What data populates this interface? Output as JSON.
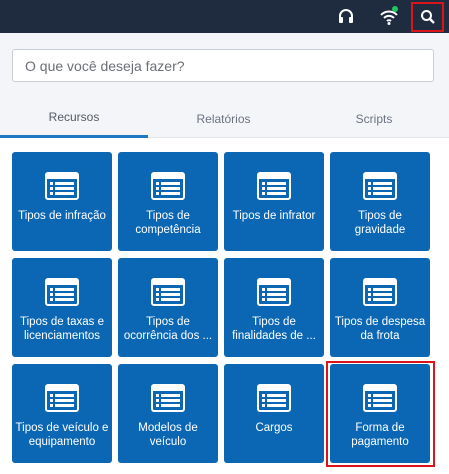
{
  "topbar": {
    "icons": [
      "headset-icon",
      "wifi-icon",
      "search-icon"
    ]
  },
  "search": {
    "placeholder": "O que você deseja fazer?"
  },
  "tabs": [
    {
      "label": "Recursos",
      "active": true
    },
    {
      "label": "Relatórios",
      "active": false
    },
    {
      "label": "Scripts",
      "active": false
    }
  ],
  "tiles": [
    {
      "label": "Tipos de infração"
    },
    {
      "label": "Tipos de competência"
    },
    {
      "label": "Tipos de infrator"
    },
    {
      "label": "Tipos de gravidade"
    },
    {
      "label": "Tipos de taxas e licenciamentos"
    },
    {
      "label": "Tipos de ocorrência dos ..."
    },
    {
      "label": "Tipos de finalidades de ..."
    },
    {
      "label": "Tipos de despesa da frota"
    },
    {
      "label": "Tipos de veículo e equipamento"
    },
    {
      "label": "Modelos de veículo"
    },
    {
      "label": "Cargos"
    },
    {
      "label": "Forma de pagamento"
    }
  ],
  "colors": {
    "topbar": "#1f2b3e",
    "tile": "#0b67b4",
    "tab_accent": "#1f78c2",
    "highlight": "#d9141b",
    "wifi_status": "#22c55e"
  }
}
